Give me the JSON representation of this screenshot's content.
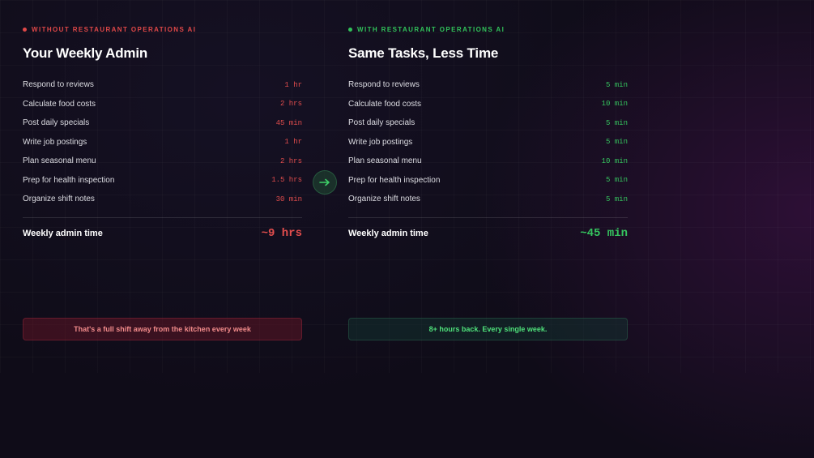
{
  "colors": {
    "without_accent": "#e04848",
    "with_accent": "#31c25a",
    "background": "#0f0c18"
  },
  "without": {
    "eyebrow": "WITHOUT RESTAURANT OPERATIONS AI",
    "heading": "Your Weekly Admin",
    "tasks": [
      {
        "label": "Respond to reviews",
        "time": "1 hr"
      },
      {
        "label": "Calculate food costs",
        "time": "2 hrs"
      },
      {
        "label": "Post daily specials",
        "time": "45 min"
      },
      {
        "label": "Write job postings",
        "time": "1 hr"
      },
      {
        "label": "Plan seasonal menu",
        "time": "2 hrs"
      },
      {
        "label": "Prep for health inspection",
        "time": "1.5 hrs"
      },
      {
        "label": "Organize shift notes",
        "time": "30 min"
      }
    ],
    "total_label": "Weekly admin time",
    "total_value": "~9 hrs",
    "callout": "That's a full shift away from the kitchen every week"
  },
  "with": {
    "eyebrow": "WITH RESTAURANT OPERATIONS AI",
    "heading": "Same Tasks, Less Time",
    "tasks": [
      {
        "label": "Respond to reviews",
        "time": "5 min"
      },
      {
        "label": "Calculate food costs",
        "time": "10 min"
      },
      {
        "label": "Post daily specials",
        "time": "5 min"
      },
      {
        "label": "Write job postings",
        "time": "5 min"
      },
      {
        "label": "Plan seasonal menu",
        "time": "10 min"
      },
      {
        "label": "Prep for health inspection",
        "time": "5 min"
      },
      {
        "label": "Organize shift notes",
        "time": "5 min"
      }
    ],
    "total_label": "Weekly admin time",
    "total_value": "~45 min",
    "callout": "8+ hours back. Every single week."
  },
  "divider_icon": "arrow-right-icon"
}
